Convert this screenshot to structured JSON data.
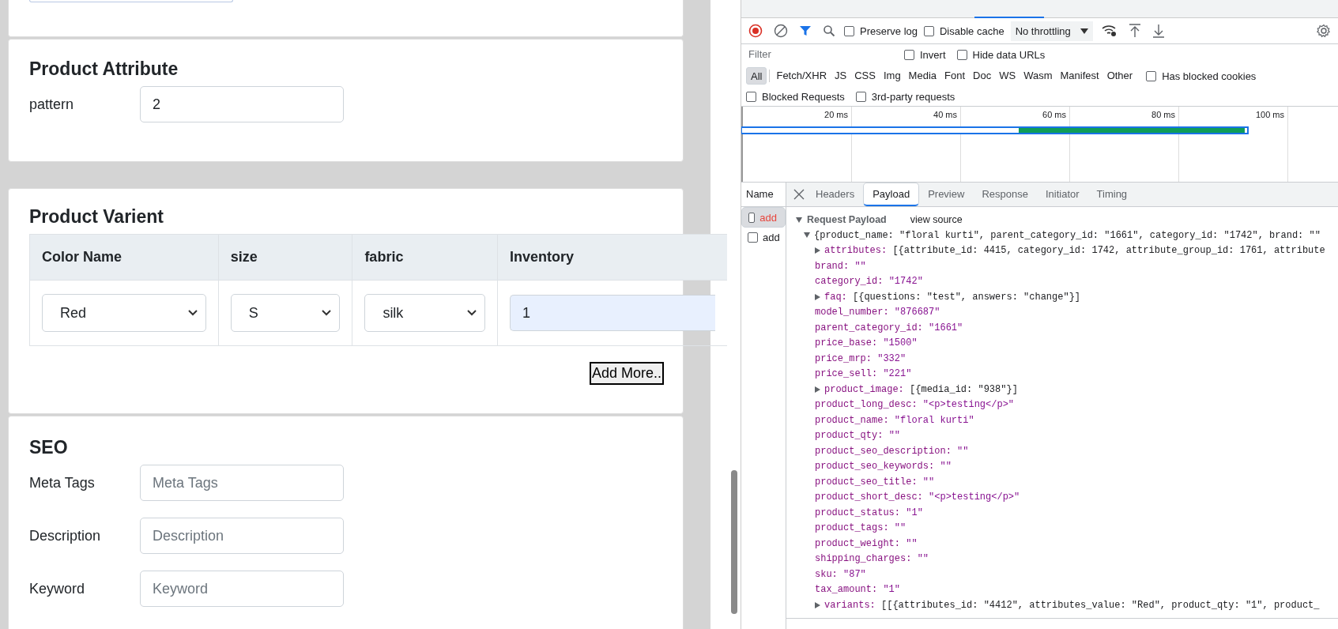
{
  "form": {
    "attribute_section": {
      "title": "Product Attribute",
      "fields": [
        {
          "label": "pattern",
          "value": "2"
        }
      ]
    },
    "variant_section": {
      "title": "Product Varient",
      "columns": [
        "Color Name",
        "size",
        "fabric",
        "Inventory"
      ],
      "rows": [
        [
          {
            "kind": "select",
            "value": "Red"
          },
          {
            "kind": "select",
            "value": "S"
          },
          {
            "kind": "select",
            "value": "silk"
          },
          {
            "kind": "input",
            "value": "1"
          }
        ]
      ],
      "add_button": "Add More.."
    },
    "seo_section": {
      "title": "SEO",
      "fields": [
        {
          "label": "Meta Tags",
          "placeholder": "Meta Tags"
        },
        {
          "label": "Description",
          "placeholder": "Description"
        },
        {
          "label": "Keyword",
          "placeholder": "Keyword"
        }
      ]
    }
  },
  "devtools": {
    "toolbar": {
      "checkboxes": [
        {
          "label": "Preserve log",
          "checked": false
        },
        {
          "label": "Disable cache",
          "checked": false
        }
      ],
      "throttling": "No throttling"
    },
    "filter": {
      "placeholder": "Filter",
      "checkboxes": [
        {
          "label": "Invert",
          "checked": false
        },
        {
          "label": "Hide data URLs",
          "checked": false
        }
      ]
    },
    "types": [
      {
        "label": "All",
        "selected": true
      },
      {
        "label": "Fetch/XHR",
        "selected": false
      },
      {
        "label": "JS",
        "selected": false
      },
      {
        "label": "CSS",
        "selected": false
      },
      {
        "label": "Img",
        "selected": false
      },
      {
        "label": "Media",
        "selected": false
      },
      {
        "label": "Font",
        "selected": false
      },
      {
        "label": "Doc",
        "selected": false
      },
      {
        "label": "WS",
        "selected": false
      },
      {
        "label": "Wasm",
        "selected": false
      },
      {
        "label": "Manifest",
        "selected": false
      },
      {
        "label": "Other",
        "selected": false
      }
    ],
    "type_checkbox": {
      "label": "Has blocked cookies",
      "checked": false
    },
    "more_checkboxes": [
      {
        "label": "Blocked Requests",
        "checked": false
      },
      {
        "label": "3rd-party requests",
        "checked": false
      }
    ],
    "timeline_ticks": [
      "20 ms",
      "40 ms",
      "60 ms",
      "80 ms",
      "100 ms"
    ],
    "name_header": "Name",
    "requests": [
      {
        "label": "add",
        "selected": true,
        "color": "#e8453c"
      },
      {
        "label": "add",
        "selected": false,
        "color": "#202124"
      }
    ],
    "detail_tabs": [
      {
        "label": "Headers",
        "selected": false
      },
      {
        "label": "Payload",
        "selected": true
      },
      {
        "label": "Preview",
        "selected": false
      },
      {
        "label": "Response",
        "selected": false
      },
      {
        "label": "Initiator",
        "selected": false
      },
      {
        "label": "Timing",
        "selected": false
      }
    ],
    "payload": {
      "title": "Request Payload",
      "expanded": true,
      "view_source": "view source",
      "root": {
        "text": "{product_name: \"floral kurti\", parent_category_id: \"1661\", category_id: \"1742\", brand: \"\"",
        "expanded": true,
        "children": [
          {
            "kind": "collapsed",
            "key": "attributes:",
            "value": "[{attribute_id: 4415, category_id: 1742, attribute_group_id: 1761, attribute"
          },
          {
            "kind": "value",
            "key": "brand:",
            "value": "\"\""
          },
          {
            "kind": "value",
            "key": "category_id:",
            "value": "\"1742\""
          },
          {
            "kind": "collapsed",
            "key": "faq:",
            "value": "[{questions: \"test\", answers: \"change\"}]"
          },
          {
            "kind": "value",
            "key": "model_number:",
            "value": "\"876687\""
          },
          {
            "kind": "value",
            "key": "parent_category_id:",
            "value": "\"1661\""
          },
          {
            "kind": "value",
            "key": "price_base:",
            "value": "\"1500\""
          },
          {
            "kind": "value",
            "key": "price_mrp:",
            "value": "\"332\""
          },
          {
            "kind": "value",
            "key": "price_sell:",
            "value": "\"221\""
          },
          {
            "kind": "collapsed",
            "key": "product_image:",
            "value": "[{media_id: \"938\"}]"
          },
          {
            "kind": "value",
            "key": "product_long_desc:",
            "value": "\"<p>testing</p>\""
          },
          {
            "kind": "value",
            "key": "product_name:",
            "value": "\"floral kurti\""
          },
          {
            "kind": "value",
            "key": "product_qty:",
            "value": "\"\""
          },
          {
            "kind": "value",
            "key": "product_seo_description:",
            "value": "\"\""
          },
          {
            "kind": "value",
            "key": "product_seo_keywords:",
            "value": "\"\""
          },
          {
            "kind": "value",
            "key": "product_seo_title:",
            "value": "\"\""
          },
          {
            "kind": "value",
            "key": "product_short_desc:",
            "value": "\"<p>testing</p>\""
          },
          {
            "kind": "value",
            "key": "product_status:",
            "value": "\"1\""
          },
          {
            "kind": "value",
            "key": "product_tags:",
            "value": "\"\""
          },
          {
            "kind": "value",
            "key": "product_weight:",
            "value": "\"\""
          },
          {
            "kind": "value",
            "key": "shipping_charges:",
            "value": "\"\""
          },
          {
            "kind": "value",
            "key": "sku:",
            "value": "\"87\""
          },
          {
            "kind": "value",
            "key": "tax_amount:",
            "value": "\"1\""
          },
          {
            "kind": "collapsed",
            "key": "variants:",
            "value": "[[{attributes_id: \"4412\", attributes_value: \"Red\", product_qty: \"1\", product_"
          }
        ]
      }
    }
  }
}
